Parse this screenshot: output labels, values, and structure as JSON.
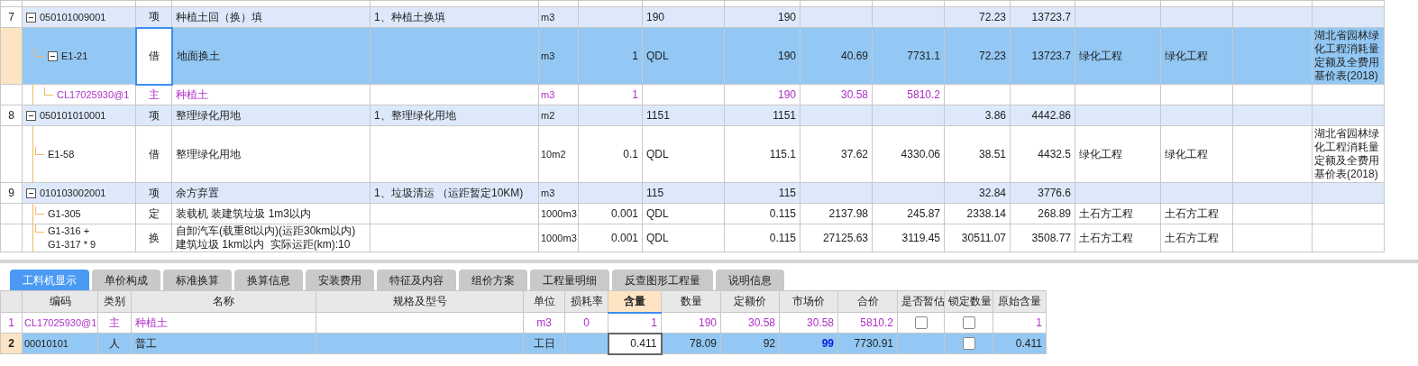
{
  "bill_table": {
    "rows": [
      {
        "number": "7",
        "code": "050101009001",
        "kind": "item",
        "selected": false,
        "editing": false,
        "expanded": true,
        "cells": [
          "项",
          "种植土回（换）填",
          "1、种植土换填",
          "m3",
          null,
          "190",
          "190",
          null,
          null,
          "72.23",
          "13723.7",
          null,
          null,
          null,
          null
        ],
        "children": [
          {
            "code": "E1-21",
            "kind": "quota",
            "selected": true,
            "editing": true,
            "expanded": true,
            "cells": [
              "借",
              "地面换土",
              null,
              "m3",
              "1",
              "QDL",
              "190",
              "40.69",
              "7731.1",
              "72.23",
              "13723.7",
              "绿化工程",
              "绿化工程",
              null,
              "湖北省园林绿化工程消耗量定额及全费用基价表(2018)"
            ],
            "children": [
              {
                "code": "CL17025930@1",
                "kind": "material",
                "selected": false,
                "editing": false,
                "cells": [
                  "主",
                  "种植土",
                  null,
                  "m3",
                  "1",
                  null,
                  "190",
                  "30.58",
                  "5810.2",
                  null,
                  null,
                  null,
                  null,
                  null,
                  null
                ]
              }
            ]
          }
        ]
      },
      {
        "number": "8",
        "code": "050101010001",
        "kind": "item",
        "selected": false,
        "editing": false,
        "expanded": true,
        "cells": [
          "项",
          "整理绿化用地",
          "1、整理绿化用地",
          "m2",
          null,
          "1151",
          "1151",
          null,
          null,
          "3.86",
          "4442.86",
          null,
          null,
          null,
          null
        ],
        "children": [
          {
            "code": "E1-58",
            "kind": "quota",
            "selected": false,
            "editing": false,
            "cells": [
              "借",
              "整理绿化用地",
              null,
              "10m2",
              "0.1",
              "QDL",
              "115.1",
              "37.62",
              "4330.06",
              "38.51",
              "4432.5",
              "绿化工程",
              "绿化工程",
              null,
              "湖北省园林绿化工程消耗量定额及全费用基价表(2018)"
            ]
          }
        ]
      },
      {
        "number": "9",
        "code": "010103002001",
        "kind": "item",
        "selected": false,
        "editing": false,
        "expanded": true,
        "cells": [
          "项",
          "余方弃置",
          "1、垃圾清运 （运距暂定10KM)",
          "m3",
          null,
          "115",
          "115",
          null,
          null,
          "32.84",
          "3776.6",
          null,
          null,
          null,
          null
        ],
        "children": [
          {
            "code": "G1-305",
            "kind": "quota",
            "selected": false,
            "editing": false,
            "cells": [
              "定",
              "装载机 装建筑垃圾 1m3以内",
              null,
              "1000m3",
              "0.001",
              "QDL",
              "0.115",
              "2137.98",
              "245.87",
              "2338.14",
              "268.89",
              "土石方工程",
              "土石方工程",
              null,
              null
            ]
          },
          {
            "code": "G1-316 +\nG1-317 * 9",
            "kind": "quota",
            "selected": false,
            "editing": false,
            "cells": [
              "换",
              "自卸汽车(载重8t以内)(运距30km以内)\n建筑垃圾 1km以内  实际运距(km):10",
              null,
              "1000m3",
              "0.001",
              "QDL",
              "0.115",
              "27125.63",
              "3119.45",
              "30511.07",
              "3508.77",
              "土石方工程",
              "土石方工程",
              null,
              null
            ]
          }
        ]
      }
    ]
  },
  "tabs": [
    {
      "label": "工料机显示",
      "selected": true
    },
    {
      "label": "单价构成",
      "selected": false
    },
    {
      "label": "标准换算",
      "selected": false
    },
    {
      "label": "换算信息",
      "selected": false
    },
    {
      "label": "安装费用",
      "selected": false
    },
    {
      "label": "特征及内容",
      "selected": false
    },
    {
      "label": "组价方案",
      "selected": false
    },
    {
      "label": "工程量明细",
      "selected": false
    },
    {
      "label": "反查图形工程量",
      "selected": false
    },
    {
      "label": "说明信息",
      "selected": false
    }
  ],
  "resource_table": {
    "columns": [
      {
        "label": "编码",
        "selected": false
      },
      {
        "label": "类别",
        "selected": false
      },
      {
        "label": "名称",
        "selected": false
      },
      {
        "label": "规格及型号",
        "selected": false
      },
      {
        "label": "单位",
        "selected": false
      },
      {
        "label": "损耗率",
        "selected": false
      },
      {
        "label": "含量",
        "selected": true
      },
      {
        "label": "数量",
        "selected": false
      },
      {
        "label": "定额价",
        "selected": false
      },
      {
        "label": "市场价",
        "selected": false
      },
      {
        "label": "合价",
        "selected": false
      },
      {
        "label": "是否暂估",
        "selected": false
      },
      {
        "label": "锁定数量",
        "selected": false
      },
      {
        "label": "原始含量",
        "selected": false
      }
    ],
    "rows": [
      {
        "number": "1",
        "kind": "material",
        "selected": false,
        "editing": false,
        "market_price_adjusted": false,
        "cells": [
          "CL17025930@1",
          "主",
          "种植土",
          null,
          "m3",
          "0",
          "1",
          "190",
          "30.58",
          "30.58",
          "5810.2"
        ],
        "estimate": {
          "checked": false
        },
        "locked": {
          "checked": false
        },
        "original_amount": "1"
      },
      {
        "number": "2",
        "kind": "labor",
        "selected": true,
        "editing": true,
        "market_price_adjusted": true,
        "cells": [
          "00010101",
          "人",
          "普工",
          null,
          "工日",
          null,
          "0.411",
          "78.09",
          "92",
          "99",
          "7730.91"
        ],
        "locked": {
          "checked": false
        },
        "original_amount": "0.411"
      }
    ]
  }
}
